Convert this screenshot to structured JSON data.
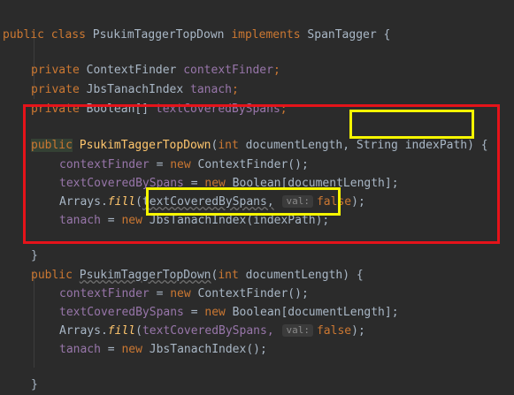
{
  "code": {
    "l1": {
      "kw1": "public",
      "kw2": "class",
      "cls": "PsukimTaggerTopDown",
      "kw3": "implements",
      "iface": "SpanTagger",
      "brace": "{"
    },
    "l3": {
      "kw": "private",
      "type": "ContextFinder",
      "name": "contextFinder",
      "semi": ";"
    },
    "l4": {
      "kw": "private",
      "type": "JbsTanachIndex",
      "name": "tanach",
      "semi": ";"
    },
    "l5": {
      "kw": "private",
      "type": "Boolean[]",
      "name": "textCoveredBySpans",
      "semi": ";"
    },
    "l7": {
      "kw": "public",
      "name": "PsukimTaggerTopDown",
      "open": "(",
      "t1": "int",
      "p1": "documentLength,",
      "t2": "String",
      "p2": "indexPath",
      "close": ")",
      "brace": "{"
    },
    "l8": {
      "fld": "contextFinder",
      "eq": " = ",
      "kw": "new",
      "call": " ContextFinder();"
    },
    "l9": {
      "fld": "textCoveredBySpans",
      "eq": " = ",
      "kw": "new",
      "call": " Boolean[documentLength];"
    },
    "l10": {
      "cls": "Arrays.",
      "m": "fill",
      "open": "(",
      "arg": "textCoveredBySpans,",
      "hint": "val:",
      "kw": "false",
      "end": ");"
    },
    "l11": {
      "fld": "tanach",
      "eq": " = ",
      "kw": "new",
      "call": "JbsTanachIndex(indexPath);"
    },
    "l13": {
      "brace": "}"
    },
    "l14": {
      "kw": "public",
      "name": "PsukimTaggerTopDown",
      "open": "(",
      "t1": "int",
      "p1": "documentLength)",
      "brace": " {"
    },
    "l15": {
      "fld": "contextFinder",
      "eq": " = ",
      "kw": "new",
      "call": " ContextFinder();"
    },
    "l16": {
      "fld": "textCoveredBySpans",
      "eq": " = ",
      "kw": "new",
      "call": " Boolean[documentLength];"
    },
    "l17": {
      "cls": "Arrays.",
      "m": "fill",
      "open": "(",
      "arg": "textCoveredBySpans,",
      "hint": "val:",
      "kw": "false",
      "end": ");"
    },
    "l18": {
      "fld": "tanach",
      "eq": " = ",
      "kw": "new",
      "call": " JbsTanachIndex();"
    },
    "l20": {
      "brace": "}"
    }
  },
  "colors": {
    "background": "#2b2b2b",
    "keyword": "#cc7832",
    "field": "#9876aa",
    "method": "#ffc66d",
    "text": "#a9b7c6",
    "annotation_red": "#e5131a",
    "annotation_yellow": "#f6f600"
  }
}
